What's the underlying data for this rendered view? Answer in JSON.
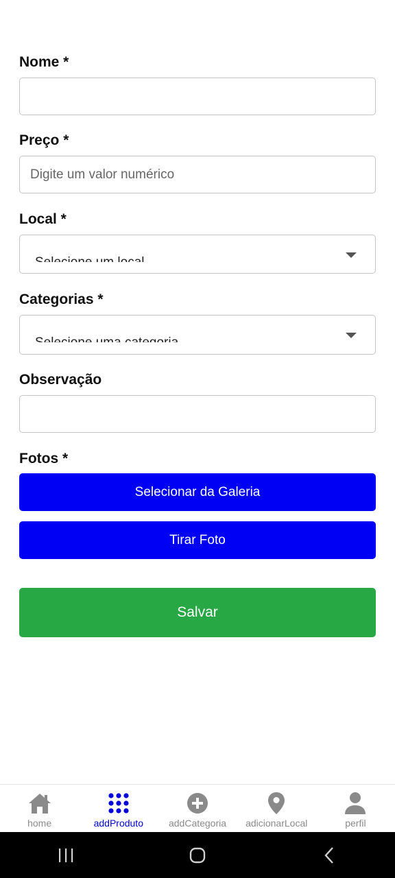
{
  "form": {
    "nome": {
      "label": "Nome *",
      "value": "",
      "placeholder": ""
    },
    "preco": {
      "label": "Preço *",
      "value": "",
      "placeholder": "Digite um valor numérico"
    },
    "local": {
      "label": "Local *",
      "selected": "Selecione um local"
    },
    "categorias": {
      "label": "Categorias *",
      "selected": "Selecione uma categoria"
    },
    "observacao": {
      "label": "Observação",
      "value": "",
      "placeholder": ""
    },
    "fotos": {
      "label": "Fotos *",
      "gallery_button": "Selecionar da Galeria",
      "camera_button": "Tirar Foto"
    },
    "save_button": "Salvar"
  },
  "tabs": [
    {
      "label": "home",
      "icon": "home-icon",
      "active": false
    },
    {
      "label": "addProduto",
      "icon": "grid-dots-icon",
      "active": true
    },
    {
      "label": "addCategoria",
      "icon": "plus-circle-icon",
      "active": false
    },
    {
      "label": "adicionarLocal",
      "icon": "location-pin-icon",
      "active": false
    },
    {
      "label": "perfil",
      "icon": "person-icon",
      "active": false
    }
  ],
  "colors": {
    "primary_blue": "#0000f5",
    "save_green": "#28a745",
    "tab_active": "#0000d8",
    "tab_inactive": "#8a8a8a"
  }
}
